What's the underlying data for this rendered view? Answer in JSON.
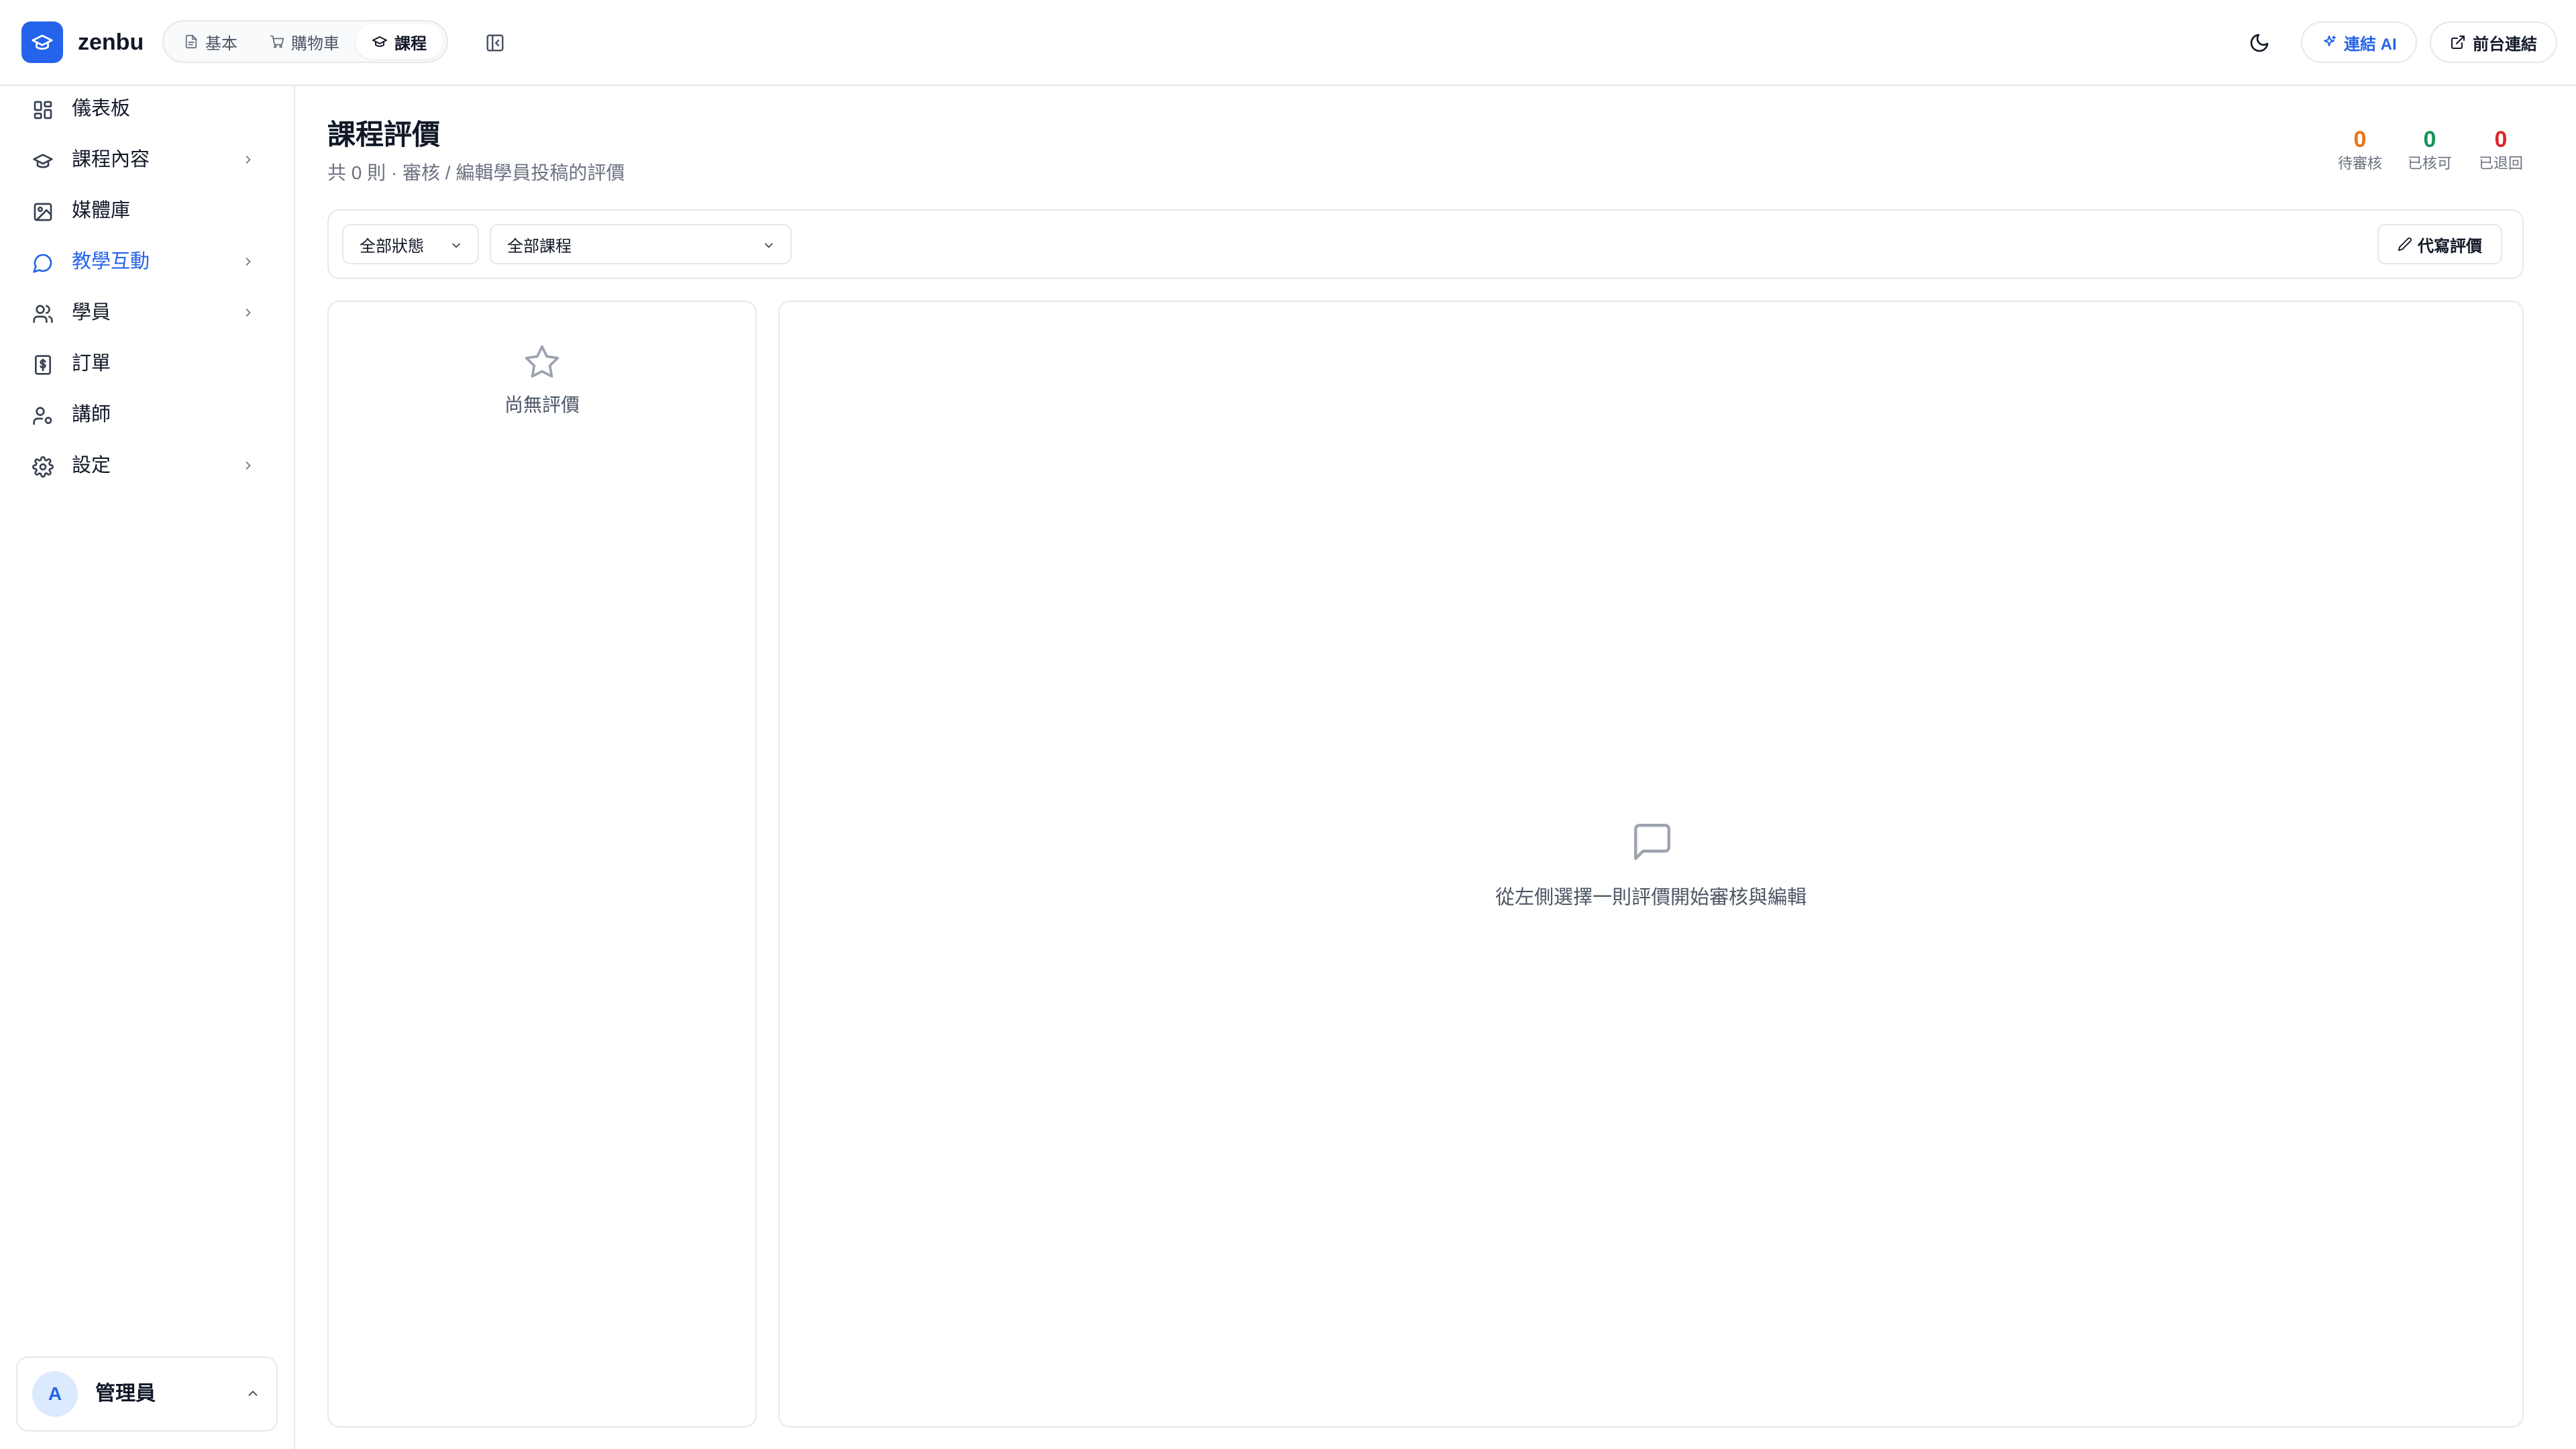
{
  "app": {
    "brand": "zenbu"
  },
  "header": {
    "tabs": [
      {
        "label": "基本",
        "icon": "document-icon",
        "active": false
      },
      {
        "label": "購物車",
        "icon": "cart-icon",
        "active": false
      },
      {
        "label": "課程",
        "icon": "graduation-cap-icon",
        "active": true
      }
    ],
    "ai_button": "連結 AI",
    "front_button": "前台連結"
  },
  "sidebar": {
    "items": [
      {
        "label": "儀表板",
        "icon": "dashboard-icon",
        "has_children": false,
        "active": false
      },
      {
        "label": "課程內容",
        "icon": "graduation-cap-icon",
        "has_children": true,
        "active": false
      },
      {
        "label": "媒體庫",
        "icon": "image-icon",
        "has_children": false,
        "active": false
      },
      {
        "label": "教學互動",
        "icon": "chat-bubble-icon",
        "has_children": true,
        "active": true
      },
      {
        "label": "學員",
        "icon": "users-icon",
        "has_children": true,
        "active": false
      },
      {
        "label": "訂單",
        "icon": "receipt-icon",
        "has_children": false,
        "active": false
      },
      {
        "label": "講師",
        "icon": "user-cog-icon",
        "has_children": false,
        "active": false
      },
      {
        "label": "設定",
        "icon": "gear-icon",
        "has_children": true,
        "active": false
      }
    ],
    "user": {
      "initial": "A",
      "name": "管理員"
    }
  },
  "main": {
    "title": "課程評價",
    "subtitle": "共 0 則 · 審核 / 編輯學員投稿的評價",
    "stats": [
      {
        "value": "0",
        "label": "待審核",
        "color": "#ea7317"
      },
      {
        "value": "0",
        "label": "已核可",
        "color": "#16935a"
      },
      {
        "value": "0",
        "label": "已退回",
        "color": "#dc2626"
      }
    ],
    "filters": {
      "status_select": "全部狀態",
      "course_select": "全部課程",
      "proxy_button": "代寫評價"
    },
    "list_empty": "尚無評價",
    "detail_empty": "從左側選擇一則評價開始審核與編輯"
  },
  "colors": {
    "accent": "#2563eb",
    "border": "#e5e7eb",
    "text_muted": "#6b7280"
  }
}
